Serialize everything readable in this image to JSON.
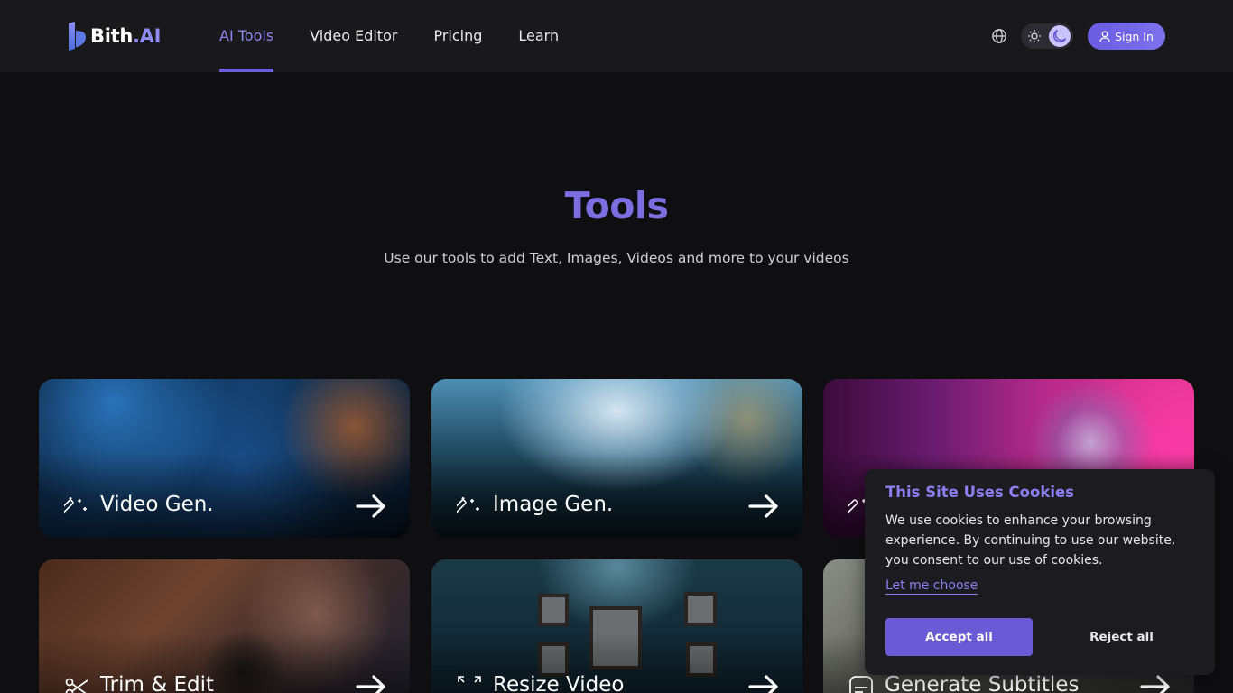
{
  "brand": {
    "name_part1": "Bith",
    "name_part2": ".AI",
    "accent": "#7d6de0"
  },
  "nav": {
    "links": [
      {
        "label": "AI Tools",
        "active": true
      },
      {
        "label": "Video Editor",
        "active": false
      },
      {
        "label": "Pricing",
        "active": false
      },
      {
        "label": "Learn",
        "active": false
      }
    ],
    "language_icon": "globe-icon",
    "theme_toggle": {
      "options": [
        "sun-icon",
        "moon-icon"
      ],
      "selected": "moon-icon"
    },
    "signin_label": "Sign In"
  },
  "hero": {
    "title": "Tools",
    "subtitle": "Use our tools to add Text, Images, Videos and more to your videos"
  },
  "cards": [
    {
      "label": "Video Gen.",
      "icon": "magic-wand-icon"
    },
    {
      "label": "Image Gen.",
      "icon": "magic-wand-icon"
    },
    {
      "label": "",
      "icon": "magic-wand-icon"
    },
    {
      "label": "Trim & Edit",
      "icon": "scissors-icon"
    },
    {
      "label": "Resize Video",
      "icon": "resize-icon"
    },
    {
      "label": "Generate Subtitles",
      "icon": "subtitles-icon"
    }
  ],
  "cookie_banner": {
    "title": "This Site Uses Cookies",
    "body": "We use cookies to enhance your browsing experience. By continuing to use our website, you consent to our use of cookies.",
    "link": "Let me choose",
    "accept_label": "Accept all",
    "reject_label": "Reject all"
  }
}
